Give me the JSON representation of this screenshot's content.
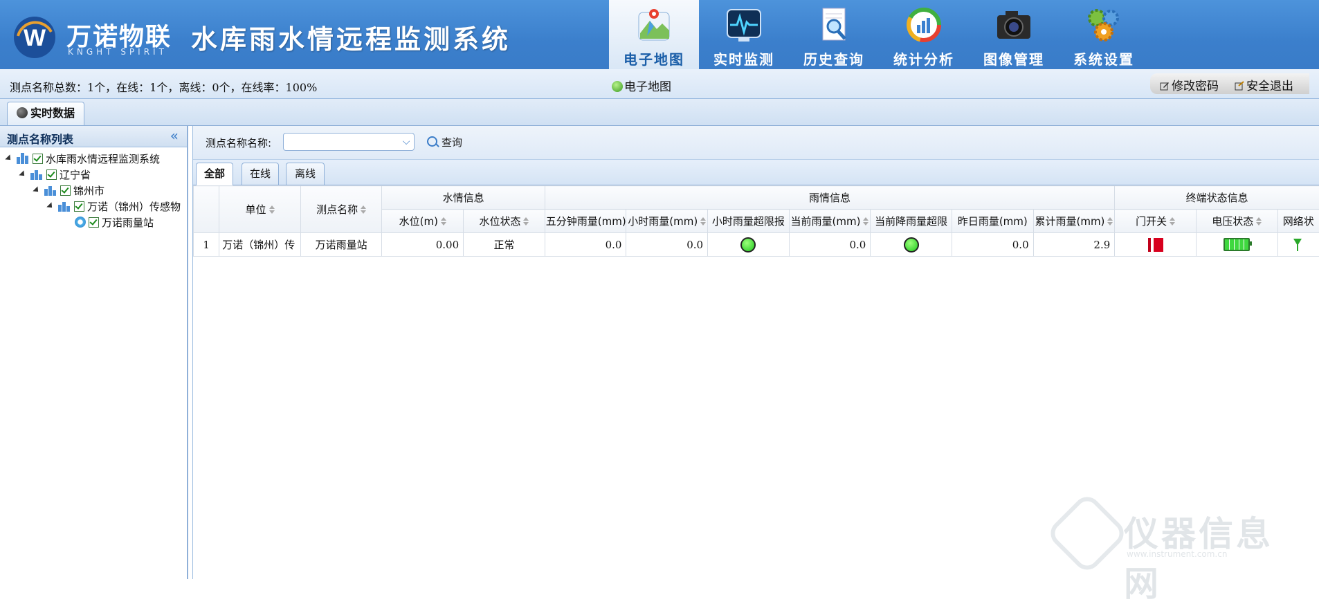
{
  "brand": {
    "name": "万诺物联",
    "tagline": "KNGHT SPIRIT",
    "logo_letter": "W"
  },
  "system_title": "水库雨水情远程监测系统",
  "nav": [
    {
      "label": "电子地图",
      "icon": "map-icon",
      "active": true
    },
    {
      "label": "实时监测",
      "icon": "monitor-icon",
      "active": false
    },
    {
      "label": "历史查询",
      "icon": "document-search-icon",
      "active": false
    },
    {
      "label": "统计分析",
      "icon": "chart-icon",
      "active": false
    },
    {
      "label": "图像管理",
      "icon": "camera-icon",
      "active": false
    },
    {
      "label": "系统设置",
      "icon": "gears-icon",
      "active": false
    }
  ],
  "stats_text": "测点名称总数：1个，在线：1个，离线：0个，在线率：100%",
  "breadcrumb": "电子地图",
  "user_actions": {
    "change_password": "修改密码",
    "logout": "安全退出"
  },
  "main_tab": "实时数据",
  "left_panel": {
    "title": "测点名称列表",
    "tree": [
      {
        "label": "水库雨水情远程监测系统",
        "level": 0
      },
      {
        "label": "辽宁省",
        "level": 1
      },
      {
        "label": "锦州市",
        "level": 2
      },
      {
        "label": "万诺（锦州）传感物",
        "level": 3
      },
      {
        "label": "万诺雨量站",
        "level": 4
      }
    ]
  },
  "search": {
    "label": "测点名称名称:",
    "value": "",
    "button": "查询"
  },
  "sub_tabs": [
    "全部",
    "在线",
    "离线"
  ],
  "table": {
    "groups": {
      "water": "水情信息",
      "rain": "雨情信息",
      "terminal": "终端状态信息"
    },
    "headers": {
      "unit": "单位",
      "station": "测点名称",
      "water_level": "水位(m)",
      "water_status": "水位状态",
      "rain_5min": "五分钟雨量(mm)",
      "rain_hour": "小时雨量(mm)",
      "rain_hour_alarm": "小时雨量超限报",
      "rain_current": "当前雨量(mm)",
      "rain_current_alarm": "当前降雨量超限",
      "rain_yesterday": "昨日雨量(mm)",
      "rain_total": "累计雨量(mm)",
      "door": "门开关",
      "voltage": "电压状态",
      "network": "网络状"
    },
    "rows": [
      {
        "index": "1",
        "unit": "万诺（锦州）传",
        "station": "万诺雨量站",
        "water_level": "0.00",
        "water_status": "正常",
        "rain_5min": "0.0",
        "rain_hour": "0.0",
        "rain_current": "0.0",
        "rain_yesterday": "0.0",
        "rain_total": "2.9",
        "hour_alarm_color": "#22cc22",
        "current_alarm_color": "#22cc22"
      }
    ]
  },
  "watermark": {
    "text": "仪器信息网",
    "url": "www.instrument.com.cn"
  }
}
